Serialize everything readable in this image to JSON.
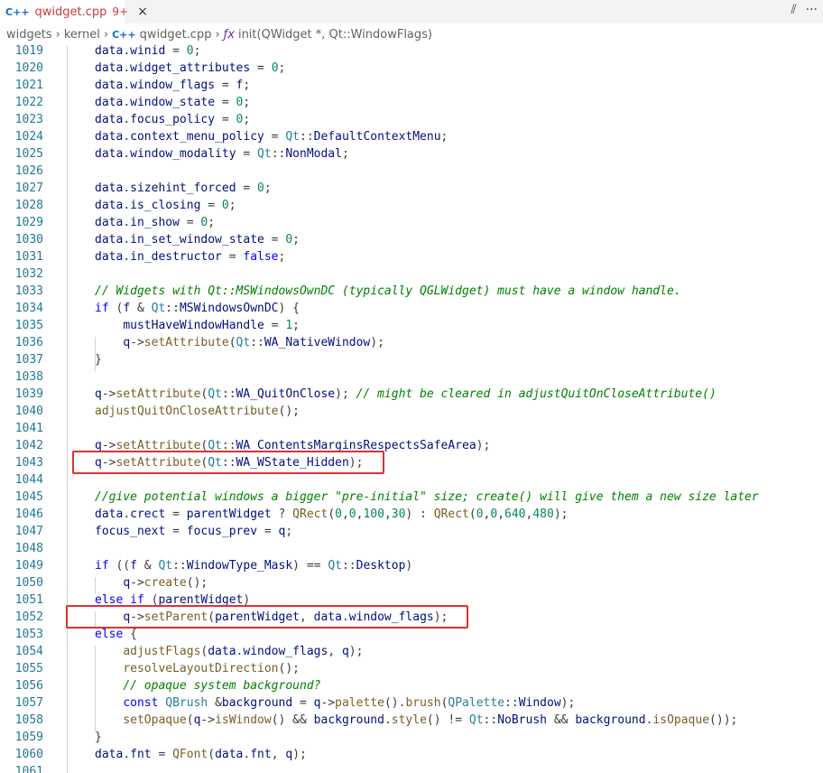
{
  "tab": {
    "icon": "C++",
    "filename": "qwidget.cpp",
    "badge": "9+",
    "close": "×"
  },
  "tab_actions": {
    "split": "⫽",
    "more": "···"
  },
  "breadcrumb": {
    "items": [
      "widgets",
      "kernel",
      "qwidget.cpp",
      "init(QWidget *, Qt::WindowFlags)"
    ],
    "file_icon": "C++",
    "fn_icon": "ƒx",
    "separator": "›"
  },
  "lines": [
    {
      "n": "1019",
      "code": "data.winid = 0;"
    },
    {
      "n": "1020",
      "code": "data.widget_attributes = 0;"
    },
    {
      "n": "1021",
      "code": "data.window_flags = f;"
    },
    {
      "n": "1022",
      "code": "data.window_state = 0;"
    },
    {
      "n": "1023",
      "code": "data.focus_policy = 0;"
    },
    {
      "n": "1024",
      "code": "data.context_menu_policy = Qt::DefaultContextMenu;"
    },
    {
      "n": "1025",
      "code": "data.window_modality = Qt::NonModal;"
    },
    {
      "n": "1026",
      "code": ""
    },
    {
      "n": "1027",
      "code": "data.sizehint_forced = 0;"
    },
    {
      "n": "1028",
      "code": "data.is_closing = 0;"
    },
    {
      "n": "1029",
      "code": "data.in_show = 0;"
    },
    {
      "n": "1030",
      "code": "data.in_set_window_state = 0;"
    },
    {
      "n": "1031",
      "code": "data.in_destructor = false;"
    },
    {
      "n": "1032",
      "code": ""
    },
    {
      "n": "1033",
      "code": "// Widgets with Qt::MSWindowsOwnDC (typically QGLWidget) must have a window handle."
    },
    {
      "n": "1034",
      "code": "if (f & Qt::MSWindowsOwnDC) {"
    },
    {
      "n": "1035",
      "code": "    mustHaveWindowHandle = 1;"
    },
    {
      "n": "1036",
      "code": "    q->setAttribute(Qt::WA_NativeWindow);"
    },
    {
      "n": "1037",
      "code": "}"
    },
    {
      "n": "1038",
      "code": ""
    },
    {
      "n": "1039",
      "code": "q->setAttribute(Qt::WA_QuitOnClose); // might be cleared in adjustQuitOnCloseAttribute()"
    },
    {
      "n": "1040",
      "code": "adjustQuitOnCloseAttribute();"
    },
    {
      "n": "1041",
      "code": ""
    },
    {
      "n": "1042",
      "code": "q->setAttribute(Qt::WA_ContentsMarginsRespectsSafeArea);"
    },
    {
      "n": "1043",
      "code": "q->setAttribute(Qt::WA_WState_Hidden);"
    },
    {
      "n": "1044",
      "code": ""
    },
    {
      "n": "1045",
      "code": "//give potential windows a bigger \"pre-initial\" size; create() will give them a new size later"
    },
    {
      "n": "1046",
      "code": "data.crect = parentWidget ? QRect(0,0,100,30) : QRect(0,0,640,480);"
    },
    {
      "n": "1047",
      "code": "focus_next = focus_prev = q;"
    },
    {
      "n": "1048",
      "code": ""
    },
    {
      "n": "1049",
      "code": "if ((f & Qt::WindowType_Mask) == Qt::Desktop)"
    },
    {
      "n": "1050",
      "code": "    q->create();"
    },
    {
      "n": "1051",
      "code": "else if (parentWidget)"
    },
    {
      "n": "1052",
      "code": "    q->setParent(parentWidget, data.window_flags);"
    },
    {
      "n": "1053",
      "code": "else {"
    },
    {
      "n": "1054",
      "code": "    adjustFlags(data.window_flags, q);"
    },
    {
      "n": "1055",
      "code": "    resolveLayoutDirection();"
    },
    {
      "n": "1056",
      "code": "    // opaque system background?"
    },
    {
      "n": "1057",
      "code": "    const QBrush &background = q->palette().brush(QPalette::Window);"
    },
    {
      "n": "1058",
      "code": "    setOpaque(q->isWindow() && background.style() != Qt::NoBrush && background.isOpaque());"
    },
    {
      "n": "1059",
      "code": "}"
    },
    {
      "n": "1060",
      "code": "data.fnt = QFont(data.fnt, q);"
    },
    {
      "n": "1061",
      "code": ""
    }
  ],
  "highlighted_lines": [
    "1043",
    "1052"
  ],
  "colors": {
    "highlight_box": "#e03131",
    "line_number": "#237893",
    "tab_title": "#c5403b"
  }
}
